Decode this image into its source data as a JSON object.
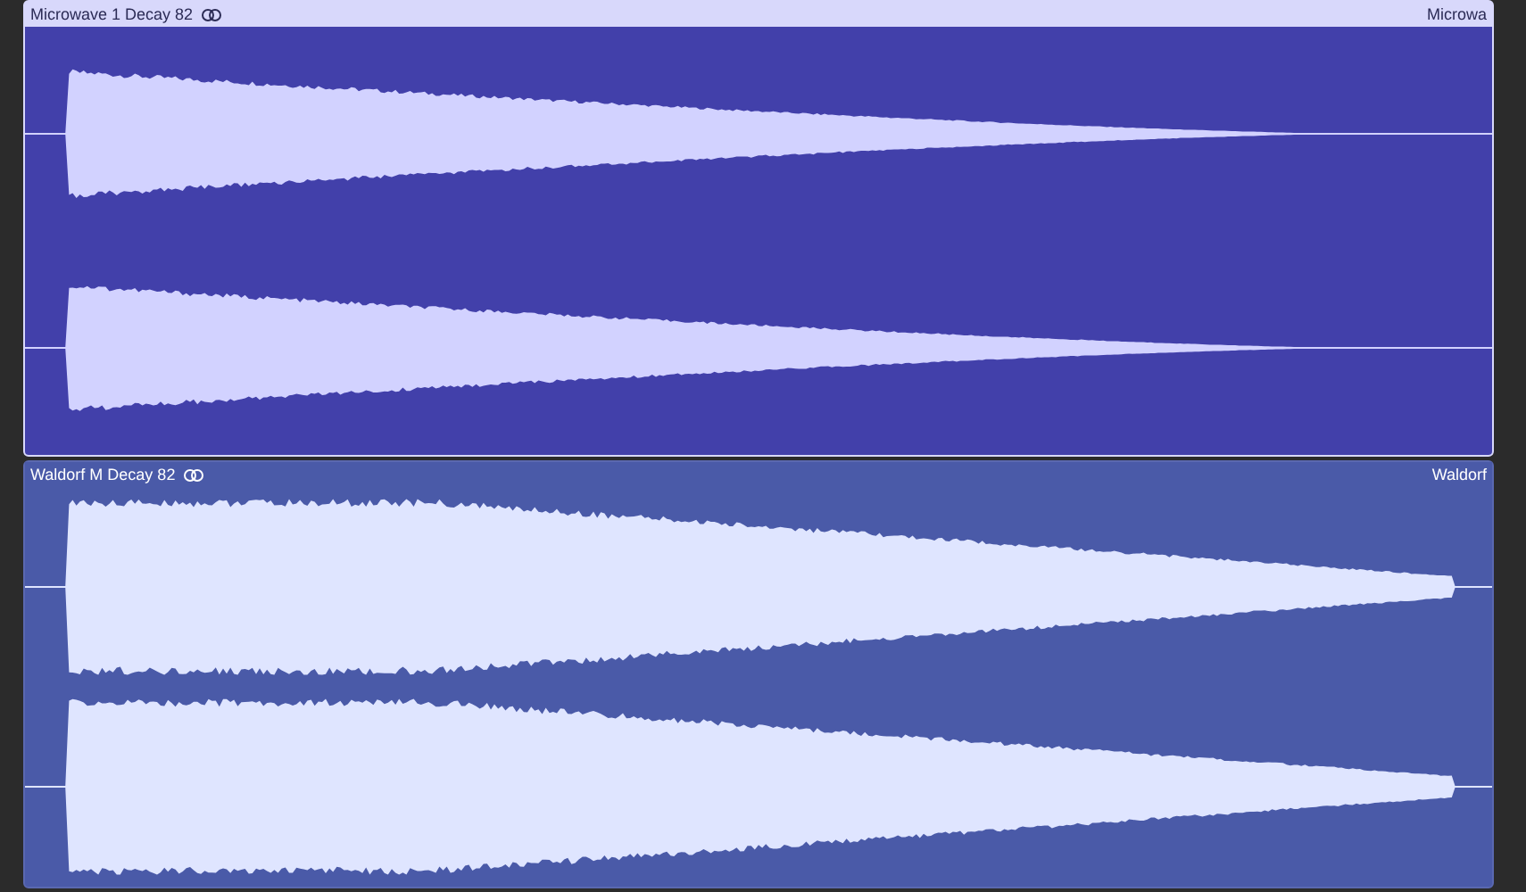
{
  "regions": [
    {
      "name": "Microwave 1 Decay 82",
      "name_right": "Microwa",
      "selected": true,
      "kind": "fast-decay"
    },
    {
      "name": "Waldorf M Decay 82",
      "name_right": "Waldorf",
      "selected": false,
      "kind": "sustained"
    }
  ]
}
